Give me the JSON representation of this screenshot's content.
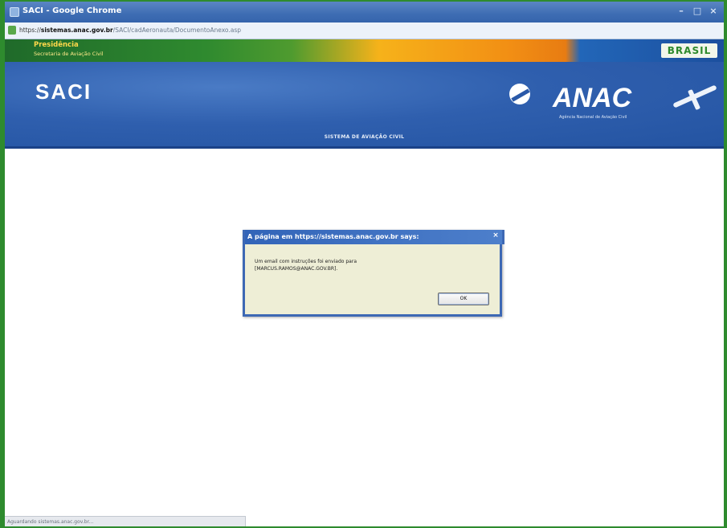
{
  "window": {
    "title": "SACI - Google Chrome",
    "controls": [
      "–",
      "□",
      "×"
    ]
  },
  "address_bar": {
    "scheme": "https://",
    "host": "sistemas.anac.gov.br",
    "path": "/SACI/cadAeronauta/DocumentoAnexo.asp"
  },
  "gov_strip": {
    "presidencia": "Presidência",
    "secretaria": "Secretaria de Aviação Civil",
    "brasil": "BRASIL"
  },
  "banner": {
    "app_name": "SACI",
    "logo_text": "ANAC",
    "logo_subtitle": "Agência Nacional de Aviação Civil",
    "system_name": "SISTEMA DE AVIAÇÃO CIVIL"
  },
  "dialog": {
    "title": "A página em https://sistemas.anac.gov.br says:",
    "close": "×",
    "message": "Um email com instruções foi enviado para\n[MARCUS.RAMOS@ANAC.GOV.BR].",
    "ok_label": "OK"
  },
  "status": {
    "text": "Aguardando sistemas.anac.gov.br..."
  },
  "colors": {
    "border_green": "#2e8b2e",
    "titlebar_blue": "#3e6db3",
    "banner_blue": "#2f5fae",
    "dialog_bg": "#eeeed6"
  }
}
